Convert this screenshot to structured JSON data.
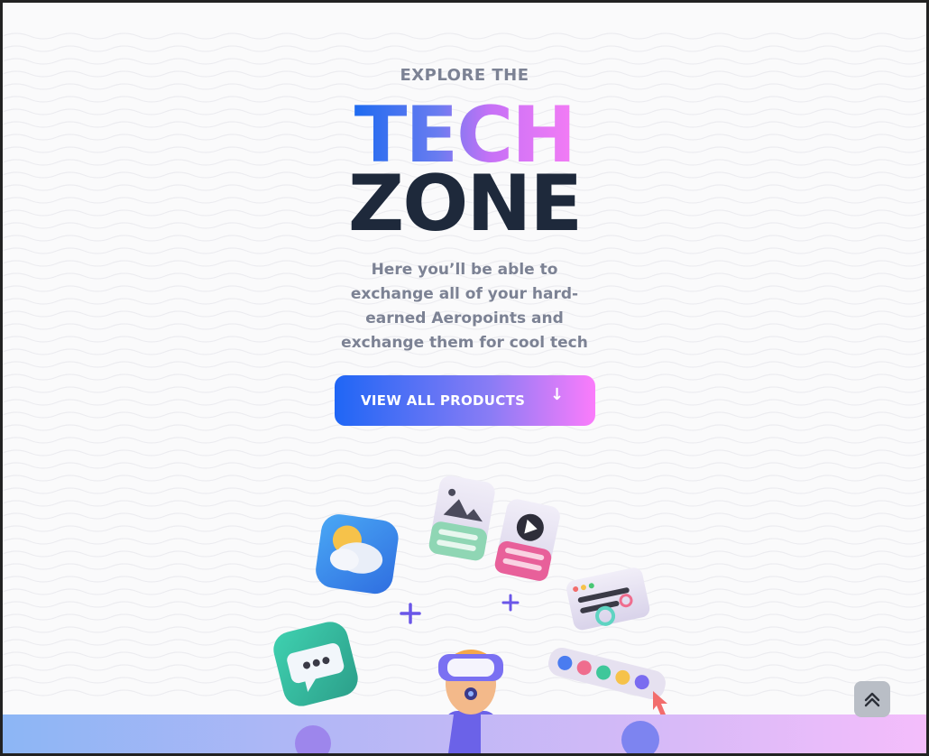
{
  "hero": {
    "eyebrow": "EXPLORE THE",
    "title_line1": "TECH",
    "title_line2": "ZONE",
    "description": "Here you’ll be able to exchange all of your hard-earned Aeropoints and exchange them for cool tech",
    "cta_label": "VIEW ALL PRODUCTS",
    "cta_icon": "arrow-down-icon"
  },
  "scroll_top": {
    "icon": "double-chevron-up-icon"
  },
  "colors": {
    "gradient_start": "#1f66f5",
    "gradient_mid": "#8a7cf5",
    "gradient_end": "#fb7cfb",
    "title_dark": "#1e293b",
    "muted_text": "#7c8294",
    "background": "#fafafb"
  }
}
